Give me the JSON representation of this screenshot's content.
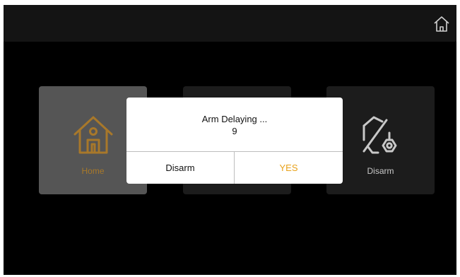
{
  "header": {
    "home_icon": "home-outline-icon"
  },
  "mode_cards": [
    {
      "label": "Home",
      "icon": "home-icon",
      "label_color": "#a8782a",
      "selected": true
    },
    {
      "label": "",
      "icon": "away-icon",
      "selected": false
    },
    {
      "label": "Disarm",
      "icon": "shield-disarm-icon",
      "label_color": "#c8c8c8",
      "selected": false
    }
  ],
  "dialog": {
    "title": "Arm Delaying ...",
    "countdown": "9",
    "buttons": {
      "disarm": "Disarm",
      "yes": "YES"
    },
    "yes_color": "#e8a21a"
  },
  "colors": {
    "background": "#000000",
    "top_bar": "#141414",
    "card": "#1c1c1c",
    "card_selected": "#555555",
    "accent": "#a8782a"
  }
}
